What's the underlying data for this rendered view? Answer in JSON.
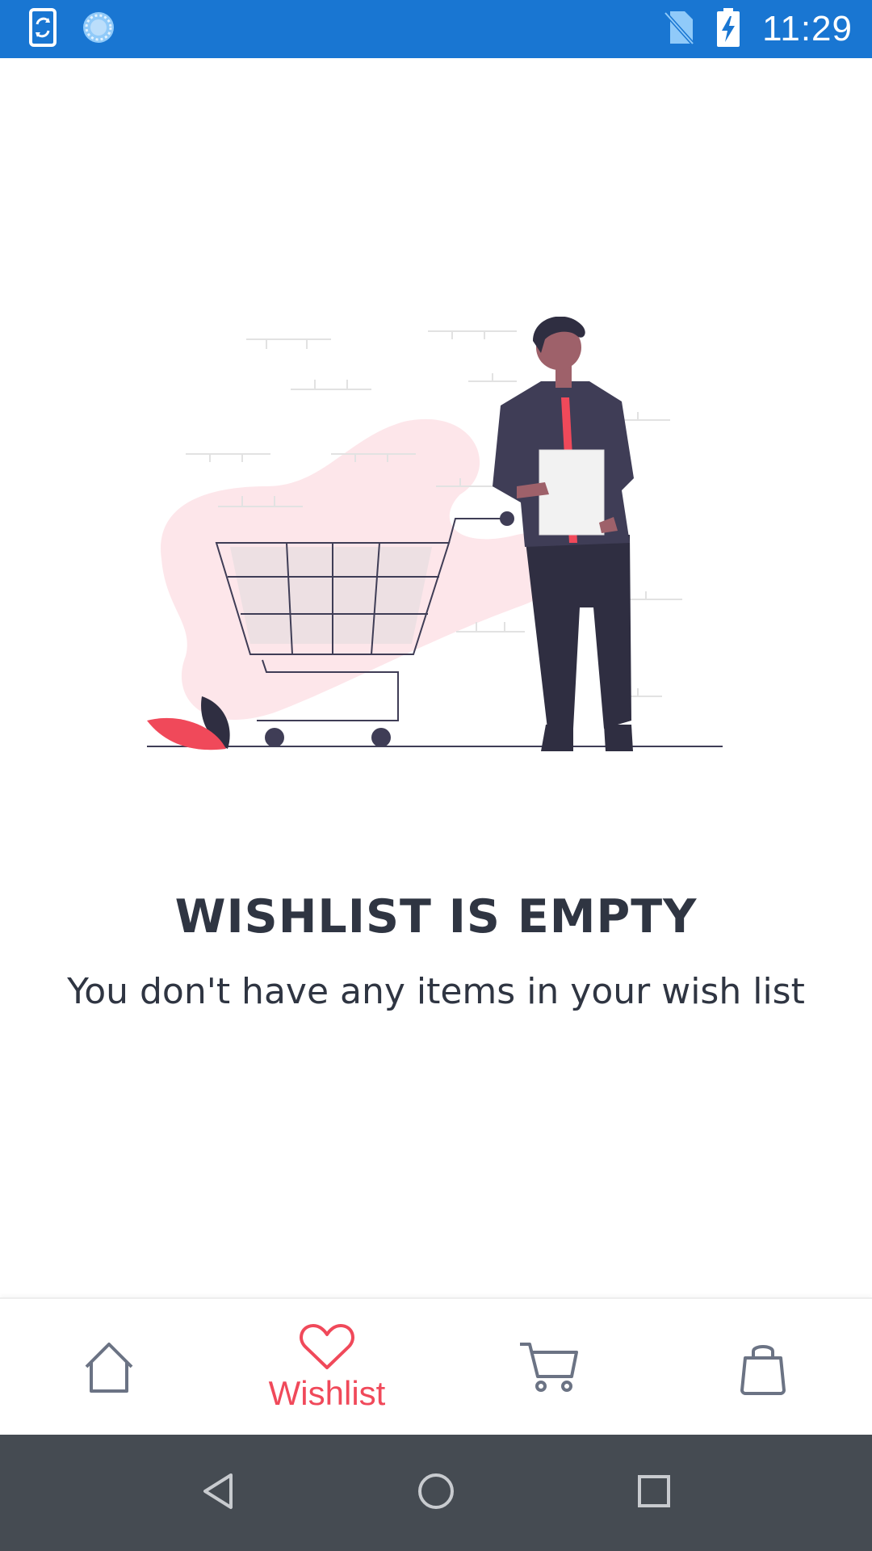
{
  "status_bar": {
    "time": "11:29",
    "background": "#1976d2",
    "icons_left": [
      "phone-sync-icon",
      "loading-spinner-icon"
    ],
    "icons_right": [
      "no-sim-icon",
      "battery-charging-icon"
    ]
  },
  "empty_state": {
    "title": "WISHLIST IS EMPTY",
    "subtitle": "You don't have any items in your wish list",
    "illustration": "person-with-shopping-cart"
  },
  "bottom_nav": {
    "active_color": "#f0495a",
    "inactive_color": "#6b7384",
    "items": [
      {
        "icon": "home-icon",
        "label": "",
        "active": false
      },
      {
        "icon": "heart-icon",
        "label": "Wishlist",
        "active": true
      },
      {
        "icon": "cart-icon",
        "label": "",
        "active": false
      },
      {
        "icon": "shopping-bag-icon",
        "label": "",
        "active": false
      }
    ]
  },
  "system_nav": {
    "background": "#454b52",
    "buttons": [
      "back-icon",
      "home-circle-icon",
      "recents-icon"
    ]
  }
}
